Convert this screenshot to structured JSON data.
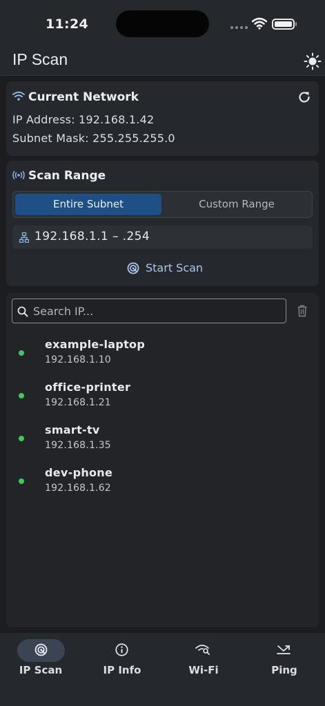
{
  "status_bar": {
    "time": "11:24"
  },
  "app_bar": {
    "title": "IP Scan",
    "theme_icon": "sun-icon"
  },
  "network": {
    "title": "Current Network",
    "ip_line": "IP Address: 192.168.1.42",
    "mask_line": "Subnet Mask: 255.255.255.0"
  },
  "scan_range": {
    "title": "Scan Range",
    "options": [
      "Entire Subnet",
      "Custom Range"
    ],
    "selected": "Entire Subnet",
    "range": "192.168.1.1 – .254",
    "start_label": "Start Scan"
  },
  "results": {
    "search_placeholder": "Search IP...",
    "devices": [
      {
        "name": "example-laptop",
        "ip": "192.168.1.10"
      },
      {
        "name": "office-printer",
        "ip": "192.168.1.21"
      },
      {
        "name": "smart-tv",
        "ip": "192.168.1.35"
      },
      {
        "name": "dev-phone",
        "ip": "192.168.1.62"
      }
    ]
  },
  "nav": {
    "items": [
      {
        "label": "IP Scan",
        "icon": "radar-icon",
        "active": true
      },
      {
        "label": "IP Info",
        "icon": "info-icon",
        "active": false
      },
      {
        "label": "Wi-Fi",
        "icon": "wifi-search-icon",
        "active": false
      },
      {
        "label": "Ping",
        "icon": "ping-icon",
        "active": false
      }
    ]
  },
  "colors": {
    "accent": "#1e4f85",
    "accent_text": "#a9c9f0",
    "online": "#3fc95a",
    "background": "#1b1d20",
    "surface": "#25282c"
  }
}
